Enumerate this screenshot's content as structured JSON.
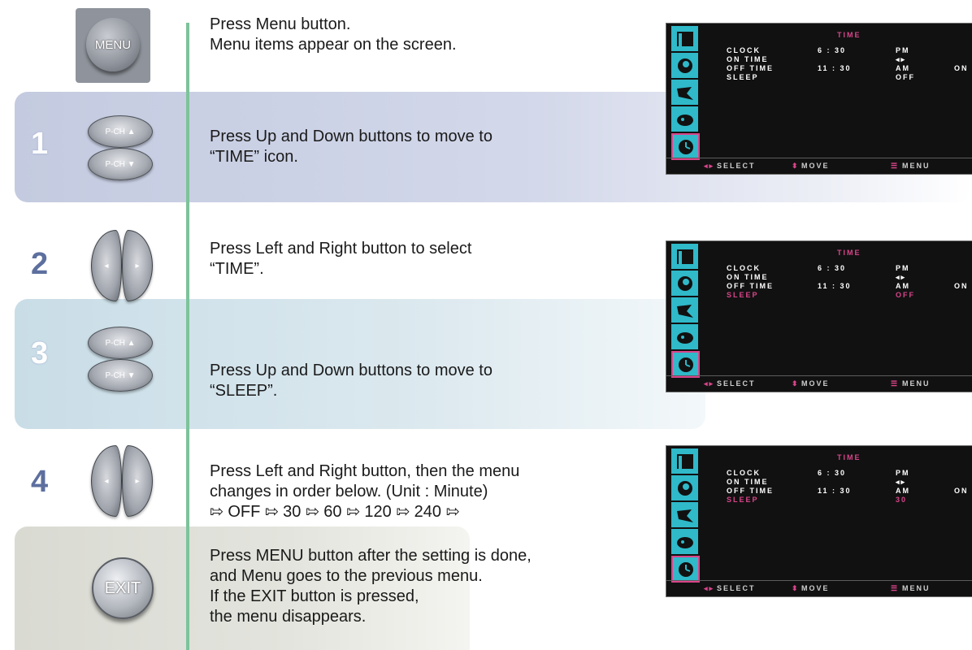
{
  "buttons": {
    "menu_label": "MENU",
    "up_label": "P-CH ▲",
    "down_label": "P-CH ▼",
    "left_arrow": "◂",
    "right_arrow": "▸",
    "exit_label": "EXIT"
  },
  "intro": {
    "line1": "Press Menu button.",
    "line2": "Menu items appear on the screen."
  },
  "steps": [
    {
      "num": "1",
      "line1": "Press Up and Down buttons to move to",
      "line2": "“TIME” icon."
    },
    {
      "num": "2",
      "line1": "Press Left and Right button to select",
      "line2": "“TIME”."
    },
    {
      "num": "3",
      "line1": "Press Up and Down buttons to move to",
      "line2": "“SLEEP”."
    },
    {
      "num": "4",
      "line1": "Press Left and Right button, then the menu",
      "line2": "changes in order below. (Unit : Minute)",
      "line3": "⇰ OFF ⇰ 30 ⇰ 60 ⇰ 120 ⇰ 240 ⇰"
    }
  ],
  "final": {
    "line1": "Press MENU button after the setting is done,",
    "line2": "and Menu goes to the previous menu.",
    "line3": "If the EXIT button is pressed,",
    "line4": "the menu disappears."
  },
  "osd": {
    "title": "TIME",
    "clock_label": "CLOCK",
    "clock_value": "6 : 30",
    "clock_ampm": "PM",
    "on_label": "ON TIME",
    "on_value": "◂▸",
    "off_label": "OFF TIME",
    "off_value": "11 : 30",
    "off_ampm": "AM",
    "off_state": "ON",
    "sleep_label": "SLEEP",
    "sleep_values": [
      "OFF",
      "OFF",
      "30"
    ],
    "footer_select": "SELECT",
    "footer_move": "MOVE",
    "footer_menu": "MENU",
    "footer_select_marker": "◂▸",
    "footer_move_marker": "⬍",
    "footer_menu_marker": "☰"
  },
  "colors": {
    "accent_pink": "#d9458a",
    "icon_cyan": "#2fb9c9",
    "guide_green": "#7cc39a"
  }
}
